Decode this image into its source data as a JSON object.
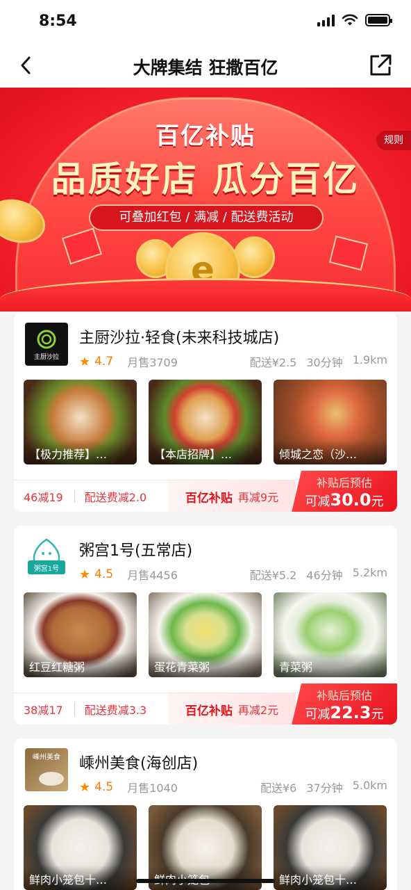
{
  "status_bar": {
    "time": "8:54"
  },
  "nav": {
    "title": "大牌集结 狂撒百亿",
    "back_icon": "chevron-left-icon",
    "share_icon": "share-icon"
  },
  "banner": {
    "top_text": "百亿补贴",
    "main_text": "品质好店 瓜分百亿",
    "pill_text": "可叠加红包 / 满减 / 配送费活动",
    "rules_label": "规则",
    "colors": {
      "primary": "#f5222d",
      "gold": "#f7c044"
    }
  },
  "stores": [
    {
      "name": "主厨沙拉·轻食(未来科技城店)",
      "logo_text": "主厨沙拉",
      "rating": "4.7",
      "sales": "月售3709",
      "delivery_fee": "配送¥2.5",
      "time": "30分钟",
      "distance": "1.9km",
      "dishes": [
        {
          "label": "【极力推荐】…"
        },
        {
          "label": "【本店招牌】…"
        },
        {
          "label": "倾城之恋（沙…"
        }
      ],
      "promo": {
        "discount": "46减19",
        "delivery_discount": "配送费减2.0",
        "brand": "百亿补贴",
        "extra": "再减9元",
        "cta_top": "补贴后预估",
        "cta_prefix": "可减",
        "cta_amount": "30.0",
        "cta_unit": "元"
      }
    },
    {
      "name": "粥宫1号(五常店)",
      "logo_text": "粥宫1号",
      "rating": "4.5",
      "sales": "月售4456",
      "delivery_fee": "配送¥5.2",
      "time": "46分钟",
      "distance": "5.2km",
      "dishes": [
        {
          "label": "红豆红糖粥"
        },
        {
          "label": "蛋花青菜粥"
        },
        {
          "label": "青菜粥"
        }
      ],
      "promo": {
        "discount": "38减17",
        "delivery_discount": "配送费减3.3",
        "brand": "百亿补贴",
        "extra": "再减2元",
        "cta_top": "补贴后预估",
        "cta_prefix": "可减",
        "cta_amount": "22.3",
        "cta_unit": "元"
      }
    },
    {
      "name": "嵊州美食(海创店)",
      "logo_text": "嵊州美食",
      "rating": "4.5",
      "sales": "月售1040",
      "delivery_fee": "配送¥6",
      "time": "37分钟",
      "distance": "5.0km",
      "dishes": [
        {
          "label": "鲜肉小笼包十…"
        },
        {
          "label": "鲜肉小笼包"
        },
        {
          "label": "鲜肉小笼包十…"
        }
      ]
    }
  ]
}
